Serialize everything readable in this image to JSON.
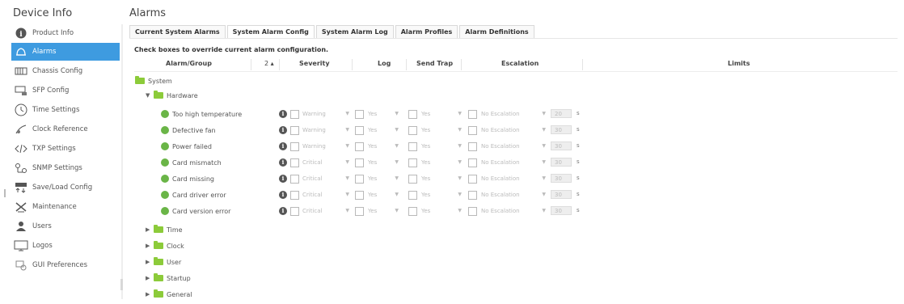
{
  "sidebar": {
    "title": "Device Info",
    "items": [
      {
        "label": "Product Info",
        "icon": "info-icon"
      },
      {
        "label": "Alarms",
        "icon": "alarm-bell-icon",
        "active": true
      },
      {
        "label": "Chassis Config",
        "icon": "chassis-icon"
      },
      {
        "label": "SFP Config",
        "icon": "sfp-icon"
      },
      {
        "label": "Time Settings",
        "icon": "clock-icon"
      },
      {
        "label": "Clock Reference",
        "icon": "satellite-icon"
      },
      {
        "label": "TXP Settings",
        "icon": "code-icon"
      },
      {
        "label": "SNMP Settings",
        "icon": "network-icon"
      },
      {
        "label": "Save/Load Config",
        "icon": "save-load-icon"
      },
      {
        "label": "Maintenance",
        "icon": "tools-icon"
      },
      {
        "label": "Users",
        "icon": "user-icon"
      },
      {
        "label": "Logos",
        "icon": "monitor-icon"
      },
      {
        "label": "GUI Preferences",
        "icon": "gui-preferences-icon"
      }
    ]
  },
  "main": {
    "title": "Alarms",
    "tabs": [
      {
        "label": "Current System Alarms"
      },
      {
        "label": "System Alarm Config",
        "active": true
      },
      {
        "label": "System Alarm Log"
      },
      {
        "label": "Alarm Profiles"
      },
      {
        "label": "Alarm Definitions"
      }
    ],
    "instruction": "Check boxes to override current alarm configuration.",
    "columns": {
      "alarm_group": "Alarm/Group",
      "sort": "2 ▴",
      "severity": "Severity",
      "log": "Log",
      "send_trap": "Send Trap",
      "escalation": "Escalation",
      "limits": "Limits"
    },
    "tree": {
      "root": "System",
      "expanded_group": "Hardware",
      "alarms": [
        {
          "name": "Too high temperature",
          "severity": "Warning",
          "log": "Yes",
          "trap": "Yes",
          "escalation": "No Escalation",
          "limit": "20",
          "unit": "s"
        },
        {
          "name": "Defective fan",
          "severity": "Warning",
          "log": "Yes",
          "trap": "Yes",
          "escalation": "No Escalation",
          "limit": "30",
          "unit": "s"
        },
        {
          "name": "Power failed",
          "severity": "Warning",
          "log": "Yes",
          "trap": "Yes",
          "escalation": "No Escalation",
          "limit": "30",
          "unit": "s"
        },
        {
          "name": "Card mismatch",
          "severity": "Critical",
          "log": "Yes",
          "trap": "Yes",
          "escalation": "No Escalation",
          "limit": "30",
          "unit": "s"
        },
        {
          "name": "Card missing",
          "severity": "Critical",
          "log": "Yes",
          "trap": "Yes",
          "escalation": "No Escalation",
          "limit": "30",
          "unit": "s"
        },
        {
          "name": "Card driver error",
          "severity": "Critical",
          "log": "Yes",
          "trap": "Yes",
          "escalation": "No Escalation",
          "limit": "30",
          "unit": "s"
        },
        {
          "name": "Card version error",
          "severity": "Critical",
          "log": "Yes",
          "trap": "Yes",
          "escalation": "No Escalation",
          "limit": "30",
          "unit": "s"
        }
      ],
      "collapsed_groups": [
        "Time",
        "Clock",
        "User",
        "Startup",
        "General"
      ]
    }
  },
  "colors": {
    "active_item": "#3e9be0",
    "folder": "#8ccb3a",
    "status_dot": "#6ab547"
  }
}
